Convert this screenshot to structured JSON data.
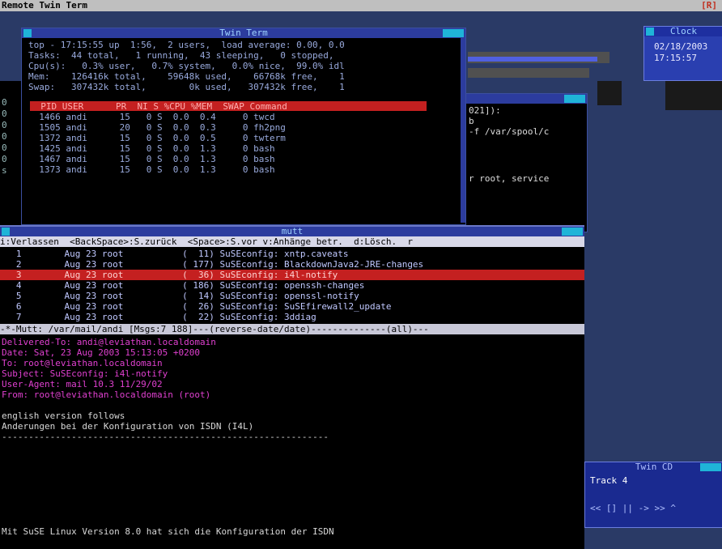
{
  "menubar": {
    "title": "Remote Twin Term",
    "right": "[R]"
  },
  "top_window": {
    "title": "Twin Term",
    "lines": [
      "top - 17:15:55 up  1:56,  2 users,  load average: 0.00, 0.0",
      "Tasks:  44 total,   1 running,  43 sleeping,   0 stopped,",
      "Cpu(s):   0.3% user,   0.7% system,   0.0% nice,  99.0% idl",
      "Mem:    126416k total,    59648k used,    66768k free,    1",
      "Swap:   307432k total,        0k used,   307432k free,    1"
    ],
    "proc_header": "  PID USER      PR  NI S %CPU %MEM  SWAP Command",
    "processes": [
      "  1466 andi      15   0 S  0.0  0.4     0 twcd",
      "  1505 andi      20   0 S  0.0  0.3     0 fh2png",
      "  1372 andi      15   0 S  0.0  0.5     0 twterm",
      "  1425 andi      15   0 S  0.0  1.3     0 bash",
      "  1467 andi      15   0 S  0.0  1.3     0 bash",
      "  1373 andi      15   0 S  0.0  1.3     0 bash"
    ]
  },
  "side_window": {
    "lines": [
      "021]):",
      "b",
      "-f /var/spool/c",
      "r root, service"
    ]
  },
  "left_strip": [
    "0",
    "0",
    "0",
    "0",
    "0",
    "0",
    "s"
  ],
  "mutt_window": {
    "title": "mutt",
    "helpbar": "i:Verlassen  <BackSpace>:S.zurück  <Space>:S.vor v:Anhänge betr.  d:Lösch.  r",
    "rows": [
      "   1        Aug 23 root           (  11) SuSEconfig: xntp.caveats",
      "   2        Aug 23 root           ( 177) SuSEconfig: BlackdownJava2-JRE-changes",
      "   3        Aug 23 root           (  36) SuSEconfig: i4l-notify",
      "   4        Aug 23 root           ( 186) SuSEconfig: openssh-changes",
      "   5        Aug 23 root           (  14) SuSEconfig: openssl-notify",
      "   6        Aug 23 root           (  26) SuSEconfig: SuSEfirewall2_update",
      "   7        Aug 23 root           (  22) SuSEconfig: 3ddiag"
    ],
    "selected_index": 2,
    "status": "-*-Mutt: /var/mail/andi [Msgs:7 188]---(reverse-date/date)--------------(all)---",
    "headers": [
      "Delivered-To: andi@leviathan.localdomain",
      "Date: Sat, 23 Aug 2003 15:13:05 +0200",
      "To: root@leviathan.localdomain",
      "Subject: SuSEconfig: i4l-notify",
      "User-Agent: mail 10.3 11/29/02",
      "From: root@leviathan.localdomain (root)"
    ],
    "body": [
      "english version follows",
      "Anderungen bei der Konfiguration von ISDN (I4L)",
      "-------------------------------------------------------------",
      "",
      "Mit SuSE Linux Version 8.0 hat sich die Konfiguration der ISDN"
    ]
  },
  "clock_window": {
    "title": "Clock",
    "date": "02/18/2003",
    "time": "17:15:57"
  },
  "cd_window": {
    "title": "Twin CD",
    "track": "Track 4",
    "controls": "<< [] || -> >> ^"
  }
}
